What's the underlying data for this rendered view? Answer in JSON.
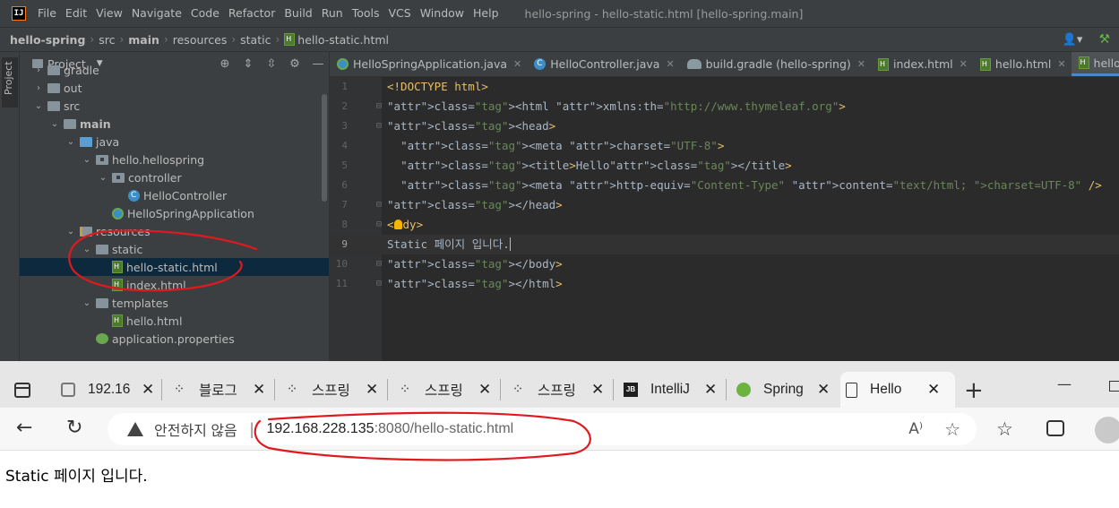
{
  "ide": {
    "menu": [
      "File",
      "Edit",
      "View",
      "Navigate",
      "Code",
      "Refactor",
      "Build",
      "Run",
      "Tools",
      "VCS",
      "Window",
      "Help"
    ],
    "window_title": "hello-spring - hello-static.html [hello-spring.main]",
    "breadcrumbs": [
      "hello-spring",
      "src",
      "main",
      "resources",
      "static",
      "hello-static.html"
    ],
    "toolstrip_label": "Project",
    "project_panel": {
      "title": "Project",
      "tree": [
        {
          "label": "gradle",
          "arrow": "right",
          "icon": "folder",
          "indent": 1
        },
        {
          "label": "out",
          "arrow": "right",
          "icon": "folder",
          "indent": 1
        },
        {
          "label": "src",
          "arrow": "down",
          "icon": "folder-src",
          "indent": 1
        },
        {
          "label": "main",
          "arrow": "down",
          "icon": "folder-src",
          "indent": 2,
          "bold": true
        },
        {
          "label": "java",
          "arrow": "down",
          "icon": "folder-java",
          "indent": 3
        },
        {
          "label": "hello.hellospring",
          "arrow": "down",
          "icon": "folder-pkg",
          "indent": 4
        },
        {
          "label": "controller",
          "arrow": "down",
          "icon": "folder-pkg",
          "indent": 5
        },
        {
          "label": "HelloController",
          "arrow": "none",
          "icon": "class",
          "indent": 6
        },
        {
          "label": "HelloSpringApplication",
          "arrow": "none",
          "icon": "springapp",
          "indent": 5
        },
        {
          "label": "resources",
          "arrow": "down",
          "icon": "folder-res",
          "indent": 3
        },
        {
          "label": "static",
          "arrow": "down",
          "icon": "folder",
          "indent": 4
        },
        {
          "label": "hello-static.html",
          "arrow": "none",
          "icon": "html",
          "indent": 5,
          "selected": true
        },
        {
          "label": "index.html",
          "arrow": "none",
          "icon": "html",
          "indent": 5
        },
        {
          "label": "templates",
          "arrow": "down",
          "icon": "folder",
          "indent": 4
        },
        {
          "label": "hello.html",
          "arrow": "none",
          "icon": "html",
          "indent": 5
        },
        {
          "label": "application.properties",
          "arrow": "none",
          "icon": "props",
          "indent": 4
        }
      ]
    },
    "editor_tabs": [
      {
        "label": "HelloSpringApplication.java",
        "icon": "spring"
      },
      {
        "label": "HelloController.java",
        "icon": "class"
      },
      {
        "label": "build.gradle (hello-spring)",
        "icon": "gradle"
      },
      {
        "label": "index.html",
        "icon": "html"
      },
      {
        "label": "hello.html",
        "icon": "html"
      },
      {
        "label": "hello-static.html",
        "icon": "html",
        "active": true
      }
    ],
    "code_lines": [
      "<!DOCTYPE html>",
      "<html xmlns:th=\"http://www.thymeleaf.org\">",
      "<head>",
      "  <meta charset=\"UTF-8\">",
      "  <title>Hello</title>",
      "  <meta http-equiv=\"Content-Type\" content=\"text/html; charset=UTF-8\" />",
      "</head>",
      "<body>",
      "Static 페이지 입니다.",
      "</body>",
      "</html>"
    ],
    "current_line": 9
  },
  "browser": {
    "tabs": [
      {
        "label": "192.16",
        "icon": "ban"
      },
      {
        "label": "블로그",
        "icon": "tree"
      },
      {
        "label": "스프링",
        "icon": "tree"
      },
      {
        "label": "스프링",
        "icon": "tree"
      },
      {
        "label": "스프링",
        "icon": "tree"
      },
      {
        "label": "IntelliJ",
        "icon": "jb"
      },
      {
        "label": "Spring",
        "icon": "spring"
      },
      {
        "label": "Hello",
        "icon": "page",
        "active": true
      }
    ],
    "security_warning": "안전하지 않음",
    "url_host": "192.168.228.135",
    "url_rest": ":8080/hello-static.html",
    "page_text": "Static 페이지 입니다."
  },
  "colors": {
    "annotation": "#e0191e",
    "ide_bg": "#2b2b2b",
    "ide_panel": "#3c3f41",
    "tab_accent": "#4a88c7"
  }
}
